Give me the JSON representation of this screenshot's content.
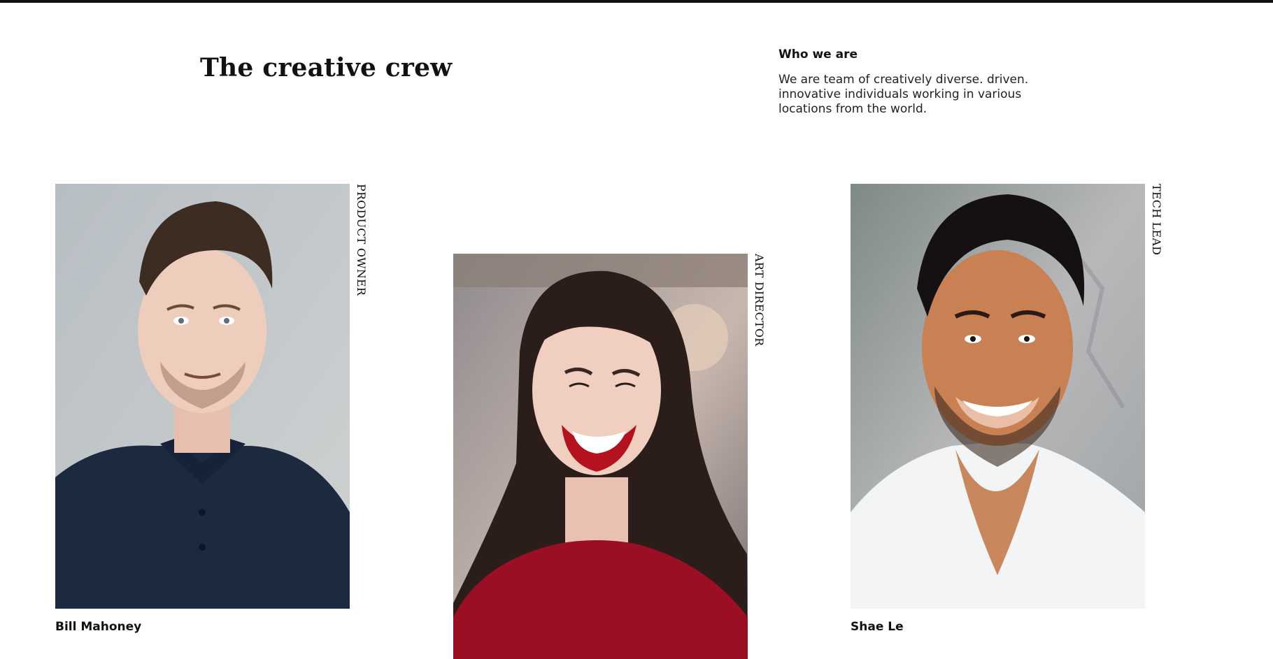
{
  "header": {
    "title": "The creative crew"
  },
  "about": {
    "title": "Who we are",
    "text": "We are team of creatively diverse. driven. innovative individuals working in various locations from the world."
  },
  "team": [
    {
      "name": "Bill Mahoney",
      "role": "PRODUCT OWNER"
    },
    {
      "name": "",
      "role": "ART DIRECTOR"
    },
    {
      "name": "Shae Le",
      "role": "TECH LEAD"
    }
  ],
  "colors": {
    "text": "#111111",
    "background": "#ffffff",
    "top_bar": "#111111"
  }
}
